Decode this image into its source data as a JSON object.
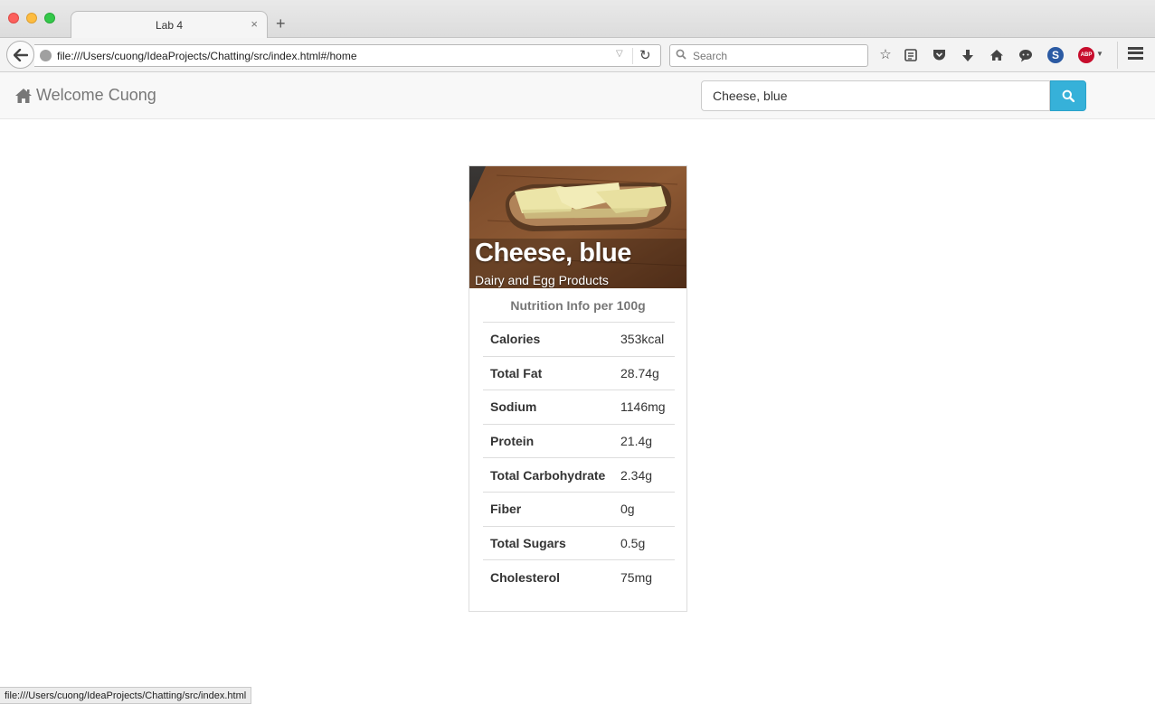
{
  "browser": {
    "tab_title": "Lab 4",
    "tab_close": "×",
    "new_tab": "+",
    "url": "file:///Users/cuong/IdeaProjects/Chatting/src/index.html#/home",
    "search_placeholder": "Search",
    "status_url": "file:///Users/cuong/IdeaProjects/Chatting/src/index.html",
    "toolbar_icons": [
      "bookmark-star-icon",
      "reading-list-icon",
      "pocket-icon",
      "download-icon",
      "home-icon",
      "chat-icon",
      "s-extension-icon",
      "adblock-icon",
      "menu-icon"
    ]
  },
  "app": {
    "brand_label": "Welcome Cuong",
    "search_value": "Cheese, blue",
    "accent_color": "#36b1d9"
  },
  "food": {
    "name": "Cheese, blue",
    "category": "Dairy and Egg Products",
    "nutrition_heading": "Nutrition Info per 100g",
    "nutrients": [
      {
        "name": "Calories",
        "value": "353kcal"
      },
      {
        "name": "Total Fat",
        "value": "28.74g"
      },
      {
        "name": "Sodium",
        "value": "1146mg"
      },
      {
        "name": "Protein",
        "value": "21.4g"
      },
      {
        "name": "Total Carbohydrate",
        "value": "2.34g"
      },
      {
        "name": "Fiber",
        "value": "0g"
      },
      {
        "name": "Total Sugars",
        "value": "0.5g"
      },
      {
        "name": "Cholesterol",
        "value": "75mg"
      }
    ]
  }
}
